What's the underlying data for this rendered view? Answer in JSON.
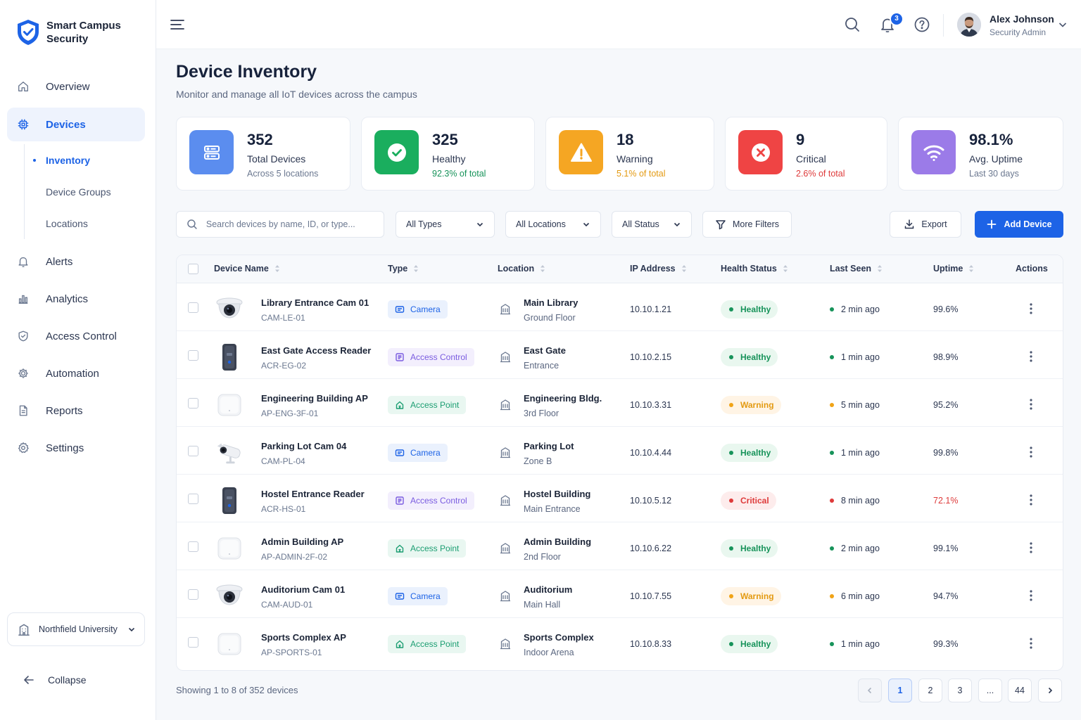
{
  "brand": {
    "line1": "Smart Campus",
    "line2": "Security"
  },
  "nav": {
    "overview": "Overview",
    "devices": "Devices",
    "sub": {
      "inventory": "Inventory",
      "groups": "Device Groups",
      "locations": "Locations"
    },
    "alerts": "Alerts",
    "analytics": "Analytics",
    "access": "Access Control",
    "automation": "Automation",
    "reports": "Reports",
    "settings": "Settings"
  },
  "org": {
    "name": "Northfield University"
  },
  "collapse_label": "Collapse",
  "header": {
    "notifications_count": "3",
    "user_name": "Alex Johnson",
    "user_role": "Security Admin"
  },
  "page": {
    "title": "Device Inventory",
    "subtitle": "Monitor and manage all IoT devices across the campus"
  },
  "stats": [
    {
      "value": "352",
      "label": "Total Devices",
      "note": "Across 5 locations",
      "color": "#5b8def",
      "note_color": "#6b7890"
    },
    {
      "value": "325",
      "label": "Healthy",
      "note": "92.3% of total",
      "color": "#1aae5e",
      "note_color": "#17935a"
    },
    {
      "value": "18",
      "label": "Warning",
      "note": "5.1% of total",
      "color": "#f5a623",
      "note_color": "#e39a12"
    },
    {
      "value": "9",
      "label": "Critical",
      "note": "2.6% of total",
      "color": "#ef4444",
      "note_color": "#de3b3b"
    },
    {
      "value": "98.1%",
      "label": "Avg. Uptime",
      "note": "Last 30 days",
      "color": "#9b7be8",
      "note_color": "#6b7890"
    }
  ],
  "filters": {
    "search_placeholder": "Search devices by name, ID, or type...",
    "types": "All Types",
    "locations": "All Locations",
    "status": "All Status",
    "more": "More Filters",
    "export": "Export",
    "add": "Add Device"
  },
  "table": {
    "headers": {
      "name": "Device Name",
      "type": "Type",
      "location": "Location",
      "ip": "IP Address",
      "health": "Health Status",
      "seen": "Last Seen",
      "uptime": "Uptime",
      "actions": "Actions"
    },
    "rows": [
      {
        "name": "Library Entrance Cam 01",
        "id": "CAM-LE-01",
        "type": "Camera",
        "kind": "camera",
        "device": "dome",
        "loc": "Main Library",
        "loc_sub": "Ground Floor",
        "ip": "10.10.1.21",
        "health": "Healthy",
        "status": "healthy",
        "seen": "2 min ago",
        "uptime": "99.6%"
      },
      {
        "name": "East Gate Access Reader",
        "id": "ACR-EG-02",
        "type": "Access Control",
        "kind": "access",
        "device": "reader",
        "loc": "East Gate",
        "loc_sub": "Entrance",
        "ip": "10.10.2.15",
        "health": "Healthy",
        "status": "healthy",
        "seen": "1 min ago",
        "uptime": "98.9%"
      },
      {
        "name": "Engineering Building AP",
        "id": "AP-ENG-3F-01",
        "type": "Access Point",
        "kind": "ap",
        "device": "ap",
        "loc": "Engineering Bldg.",
        "loc_sub": "3rd Floor",
        "ip": "10.10.3.31",
        "health": "Warning",
        "status": "warning",
        "seen": "5 min ago",
        "uptime": "95.2%"
      },
      {
        "name": "Parking Lot Cam 04",
        "id": "CAM-PL-04",
        "type": "Camera",
        "kind": "camera",
        "device": "bullet",
        "loc": "Parking Lot",
        "loc_sub": "Zone B",
        "ip": "10.10.4.44",
        "health": "Healthy",
        "status": "healthy",
        "seen": "1 min ago",
        "uptime": "99.8%"
      },
      {
        "name": "Hostel Entrance Reader",
        "id": "ACR-HS-01",
        "type": "Access Control",
        "kind": "access",
        "device": "reader",
        "loc": "Hostel Building",
        "loc_sub": "Main Entrance",
        "ip": "10.10.5.12",
        "health": "Critical",
        "status": "critical",
        "seen": "8 min ago",
        "uptime": "72.1%"
      },
      {
        "name": "Admin Building AP",
        "id": "AP-ADMIN-2F-02",
        "type": "Access Point",
        "kind": "ap",
        "device": "ap",
        "loc": "Admin Building",
        "loc_sub": "2nd Floor",
        "ip": "10.10.6.22",
        "health": "Healthy",
        "status": "healthy",
        "seen": "2 min ago",
        "uptime": "99.1%"
      },
      {
        "name": "Auditorium Cam 01",
        "id": "CAM-AUD-01",
        "type": "Camera",
        "kind": "camera",
        "device": "dome",
        "loc": "Auditorium",
        "loc_sub": "Main Hall",
        "ip": "10.10.7.55",
        "health": "Warning",
        "status": "warning",
        "seen": "6 min ago",
        "uptime": "94.7%"
      },
      {
        "name": "Sports Complex AP",
        "id": "AP-SPORTS-01",
        "type": "Access Point",
        "kind": "ap",
        "device": "ap",
        "loc": "Sports Complex",
        "loc_sub": "Indoor Arena",
        "ip": "10.10.8.33",
        "health": "Healthy",
        "status": "healthy",
        "seen": "1 min ago",
        "uptime": "99.3%"
      }
    ]
  },
  "footer": {
    "showing": "Showing 1 to 8 of 352 devices",
    "pages": [
      "1",
      "2",
      "3",
      "...",
      "44"
    ]
  }
}
